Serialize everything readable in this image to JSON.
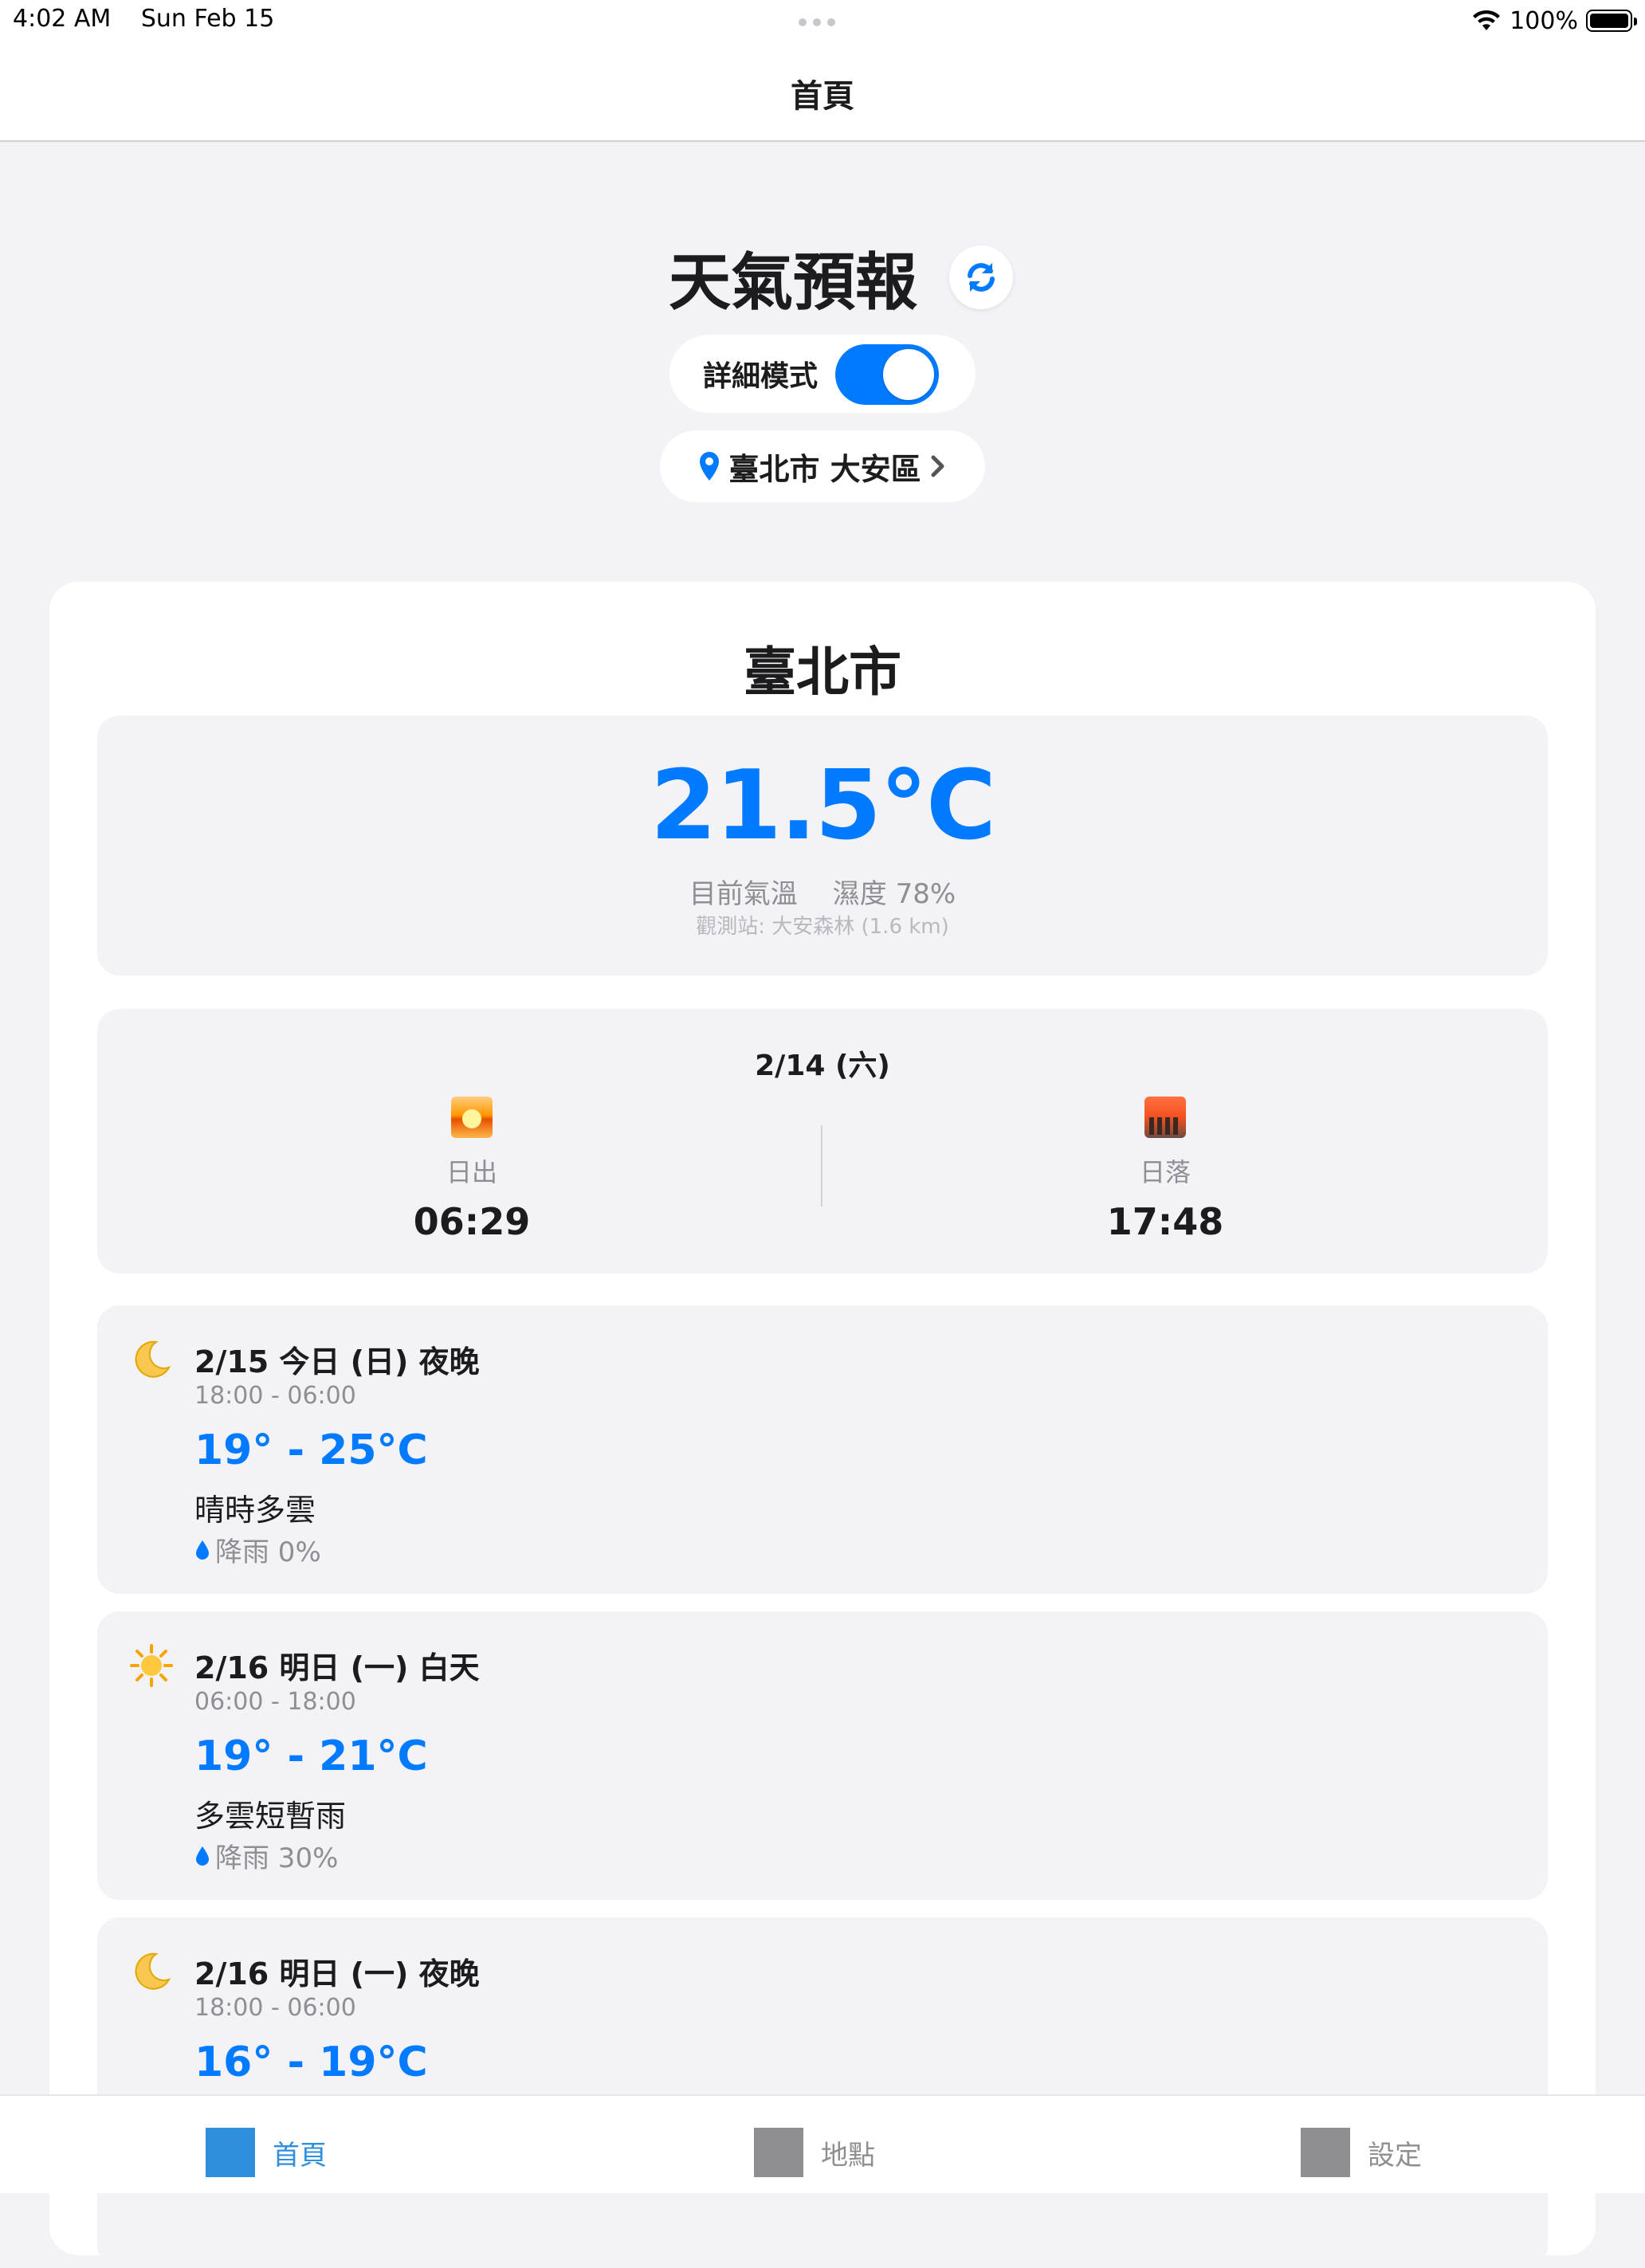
{
  "status_bar": {
    "time": "4:02 AM",
    "date": "Sun Feb 15",
    "battery": "100%",
    "wifi_icon": "wifi-icon",
    "battery_icon": "battery-icon"
  },
  "nav": {
    "title": "首頁"
  },
  "header": {
    "title": "天氣預報",
    "refresh_icon": "refresh-icon",
    "detail_mode_label": "詳細模式",
    "detail_mode_on": true,
    "location": "臺北市 大安區"
  },
  "colors": {
    "accent": "#007aff",
    "tab_active": "#2f8fdd",
    "background": "#f2f2f7"
  },
  "card": {
    "city": "臺北市",
    "current": {
      "temperature": "21.5°C",
      "label": "目前氣溫",
      "humidity": "濕度 78%",
      "station": "觀測站: 大安森林 (1.6 km)"
    },
    "sun": {
      "date": "2/14 (六)",
      "sunrise_label": "日出",
      "sunrise_time": "06:29",
      "sunset_label": "日落",
      "sunset_time": "17:48"
    },
    "forecasts": [
      {
        "icon": "moon-icon",
        "title": "2/15 今日 (日) 夜晚",
        "time": "18:00 - 06:00",
        "temp": "19° - 25°C",
        "desc": "晴時多雲",
        "rain": "降雨 0%"
      },
      {
        "icon": "sun-icon",
        "title": "2/16 明日 (一) 白天",
        "time": "06:00 - 18:00",
        "temp": "19° - 21°C",
        "desc": "多雲短暫雨",
        "rain": "降雨 30%"
      },
      {
        "icon": "moon-icon",
        "title": "2/16 明日 (一) 夜晚",
        "time": "18:00 - 06:00",
        "temp": "16° - 19°C"
      }
    ]
  },
  "tabs": [
    {
      "label": "首頁",
      "active": true
    },
    {
      "label": "地點",
      "active": false
    },
    {
      "label": "設定",
      "active": false
    }
  ]
}
